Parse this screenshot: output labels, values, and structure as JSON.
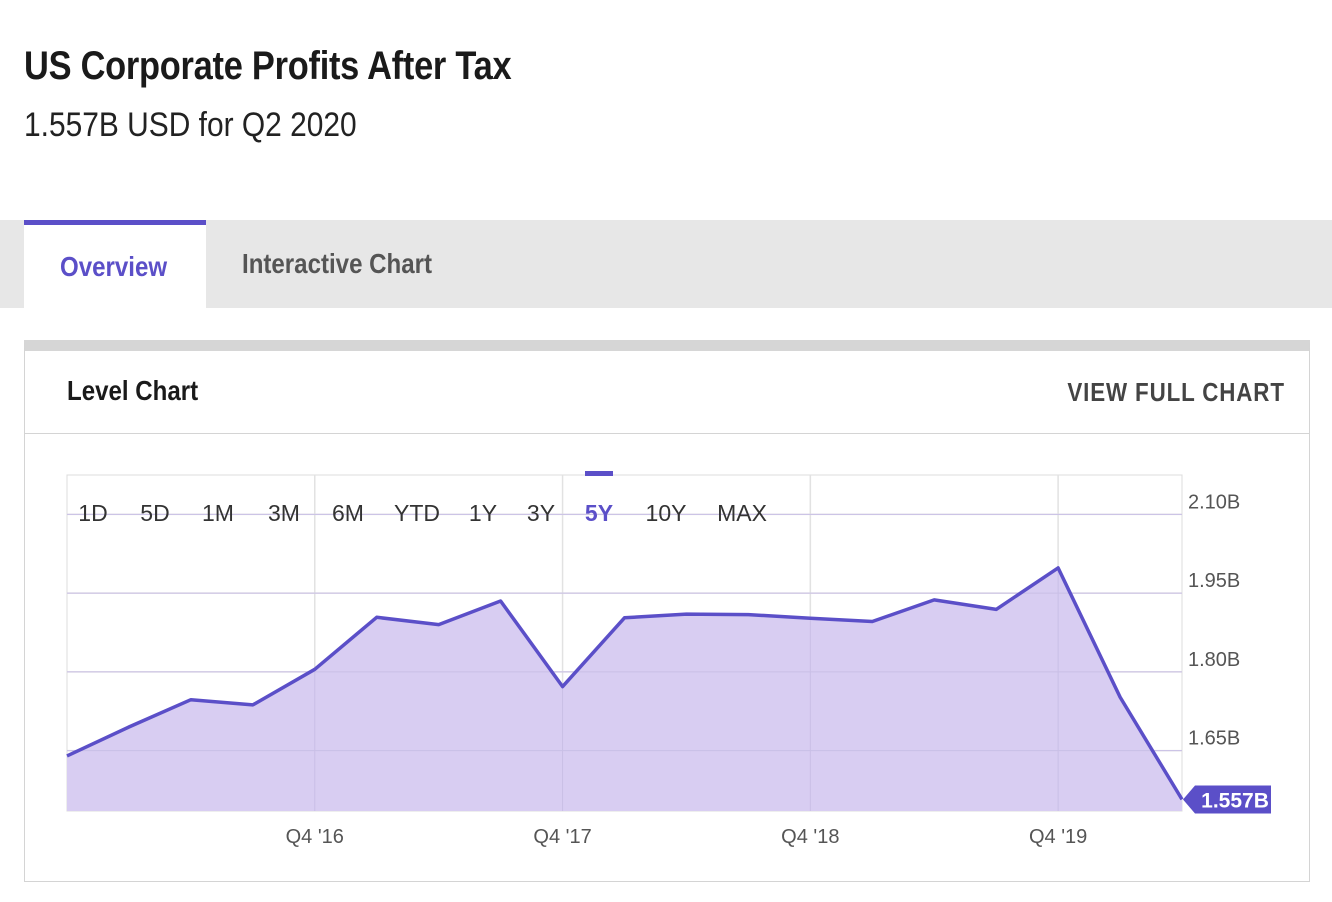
{
  "header": {
    "title": "US Corporate Profits After Tax",
    "subtitle": "1.557B USD for Q2 2020"
  },
  "tabs": [
    {
      "label": "Overview",
      "active": true
    },
    {
      "label": "Interactive Chart",
      "active": false
    }
  ],
  "card": {
    "title": "Level Chart",
    "view_full_label": "VIEW FULL CHART"
  },
  "range_buttons": [
    "1D",
    "5D",
    "1M",
    "3M",
    "6M",
    "YTD",
    "1Y",
    "3Y",
    "5Y",
    "10Y",
    "MAX"
  ],
  "selected_range": "5Y",
  "colors": {
    "accent": "#5b4fc8",
    "area_fill": "#d8cdf2",
    "grid": "#e2e2e2"
  },
  "chart_data": {
    "type": "area",
    "title": "",
    "xlabel": "",
    "ylabel": "",
    "unit": "B USD",
    "ylim": [
      1.535,
      2.175
    ],
    "y_ticks": [
      1.65,
      1.8,
      1.95,
      2.1
    ],
    "y_tick_labels": [
      "1.65B",
      "1.80B",
      "1.95B",
      "2.10B"
    ],
    "x_ticks": [
      "Q4 '16",
      "Q4 '17",
      "Q4 '18",
      "Q4 '19"
    ],
    "x_tick_index": [
      4,
      8,
      12,
      16
    ],
    "grid": true,
    "series": [
      {
        "x": [
          "Q4 '15",
          "Q1 '16",
          "Q2 '16",
          "Q3 '16",
          "Q4 '16",
          "Q1 '17",
          "Q2 '17",
          "Q3 '17",
          "Q4 '17",
          "Q1 '18",
          "Q2 '18",
          "Q3 '18",
          "Q4 '18",
          "Q1 '19",
          "Q2 '19",
          "Q3 '19",
          "Q4 '19",
          "Q1 '20",
          "Q2 '20"
        ],
        "values": [
          1.64,
          1.695,
          1.747,
          1.737,
          1.805,
          1.904,
          1.89,
          1.935,
          1.772,
          1.903,
          1.91,
          1.909,
          1.902,
          1.896,
          1.937,
          1.919,
          1.998,
          1.752,
          1.557
        ]
      }
    ],
    "last_value_label": "1.557B"
  }
}
